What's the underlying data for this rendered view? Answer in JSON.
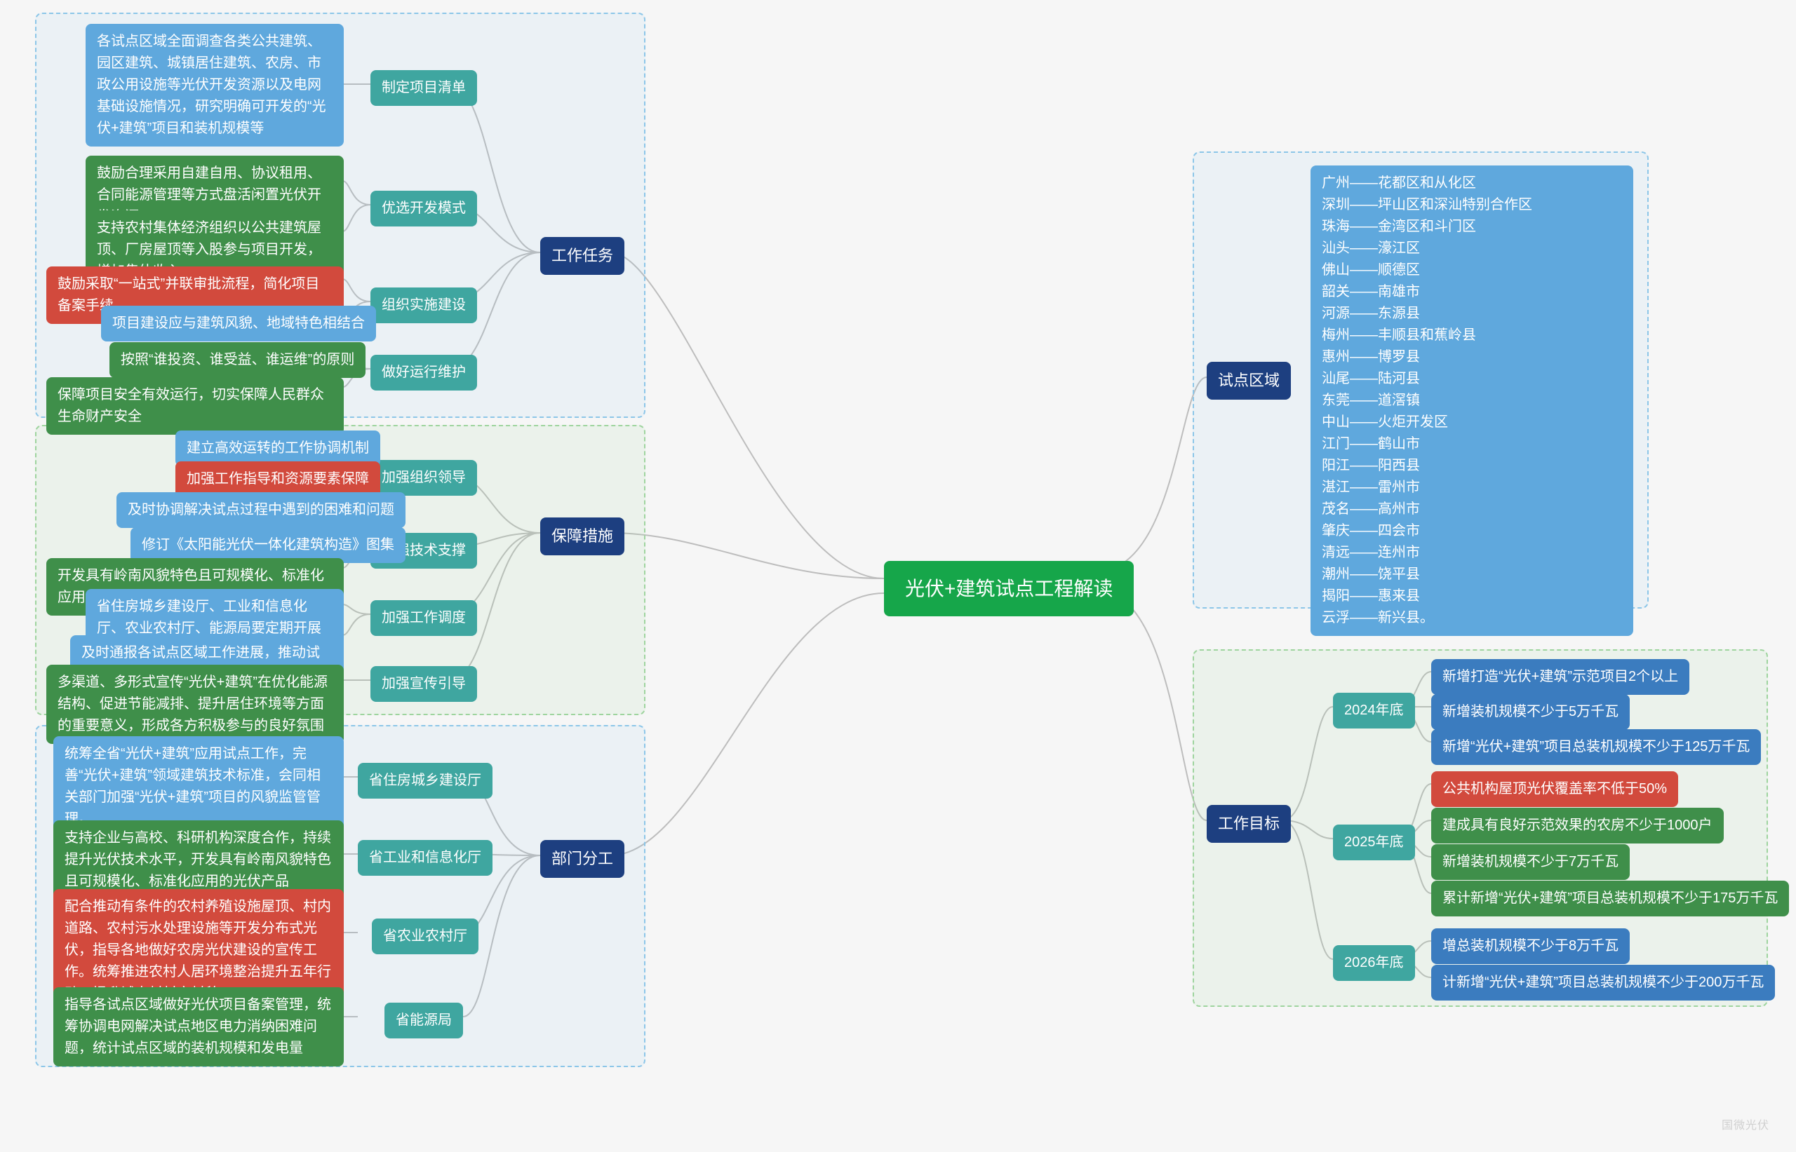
{
  "center": "光伏+建筑试点工程解读",
  "watermark": "国微光伏",
  "branches": {
    "tasks": {
      "title": "工作任务",
      "sub": [
        {
          "label": "制定项目清单",
          "leaves": [
            {
              "c": "b-blue",
              "text": "各试点区域全面调查各类公共建筑、园区建筑、城镇居住建筑、农房、市政公用设施等光伏开发资源以及电网基础设施情况，研究明确可开发的“光伏+建筑”项目和装机规模等"
            }
          ]
        },
        {
          "label": "优选开发模式",
          "leaves": [
            {
              "c": "b-green",
              "text": "鼓励合理采用自建自用、协议租用、合同能源管理等方式盘活闲置光伏开发资源"
            },
            {
              "c": "b-green",
              "text": "支持农村集体经济组织以公共建筑屋顶、厂房屋顶等入股参与项目开发，增加集体收入"
            }
          ]
        },
        {
          "label": "组织实施建设",
          "leaves": [
            {
              "c": "b-red",
              "text": "鼓励采取“一站式”并联审批流程，简化项目备案手续"
            },
            {
              "c": "b-blue",
              "text": "项目建设应与建筑风貌、地域特色相结合"
            }
          ]
        },
        {
          "label": "做好运行维护",
          "leaves": [
            {
              "c": "b-green",
              "text": "按照“谁投资、谁受益、谁运维”的原则"
            },
            {
              "c": "b-green",
              "text": "保障项目安全有效运行，切实保障人民群众生命财产安全"
            }
          ]
        }
      ]
    },
    "safeguards": {
      "title": "保障措施",
      "sub": [
        {
          "label": "加强组织领导",
          "leaves": [
            {
              "c": "b-blue",
              "text": "建立高效运转的工作协调机制"
            },
            {
              "c": "b-red",
              "text": "加强工作指导和资源要素保障"
            },
            {
              "c": "b-blue",
              "text": "及时协调解决试点过程中遇到的困难和问题"
            }
          ]
        },
        {
          "label": "加强技术支撑",
          "leaves": [
            {
              "c": "b-blue",
              "text": "修订《太阳能光伏一体化建筑构造》图集"
            },
            {
              "c": "b-green",
              "text": "开发具有岭南风貌特色且可规模化、标准化应用的光伏产品"
            }
          ]
        },
        {
          "label": "加强工作调度",
          "leaves": [
            {
              "c": "b-blue",
              "text": "省住房城乡建设厅、工业和信息化厅、农业农村厅、能源局要定期开展联合调度"
            },
            {
              "c": "b-blue",
              "text": "及时通报各试点区域工作进展，推动试点任务落地落实"
            }
          ]
        },
        {
          "label": "加强宣传引导",
          "leaves": [
            {
              "c": "b-green",
              "text": "多渠道、多形式宣传“光伏+建筑”在优化能源结构、促进节能减排、提升居住环境等方面的重要意义，形成各方积极参与的良好氛围"
            }
          ]
        }
      ]
    },
    "departments": {
      "title": "部门分工",
      "sub": [
        {
          "label": "省住房城乡建设厅",
          "leaves": [
            {
              "c": "b-blue",
              "text": "统筹全省“光伏+建筑”应用试点工作，完善“光伏+建筑”领域建筑技术标准，会同相关部门加强“光伏+建筑”项目的风貌监管管理。"
            }
          ]
        },
        {
          "label": "省工业和信息化厅",
          "leaves": [
            {
              "c": "b-green",
              "text": "支持企业与高校、科研机构深度合作，持续提升光伏技术水平，开发具有岭南风貌特色且可规模化、标准化应用的光伏产品"
            }
          ]
        },
        {
          "label": "省农业农村厅",
          "leaves": [
            {
              "c": "b-red",
              "text": "配合推动有条件的农村养殖设施屋顶、村内道路、农村污水处理设施等开发分布式光伏，指导各地做好农房光伏建设的宣传工作。统筹推进农村人居环境整治提升五年行动，提升试点村村容村貌。"
            }
          ]
        },
        {
          "label": "省能源局",
          "leaves": [
            {
              "c": "b-green",
              "text": "指导各试点区域做好光伏项目备案管理，统筹协调电网解决试点地区电力消纳困难问题，统计试点区域的装机规模和发电量"
            }
          ]
        }
      ]
    },
    "regions": {
      "title": "试点区域",
      "list_text": "广州——花都区和从化区\n深圳——坪山区和深汕特别合作区\n珠海——金湾区和斗门区\n汕头——濠江区\n佛山——顺德区\n韶关——南雄市\n河源——东源县\n梅州——丰顺县和蕉岭县\n惠州——博罗县\n汕尾——陆河县\n东莞——道滘镇\n中山——火炬开发区\n江门——鹤山市\n阳江——阳西县\n湛江——雷州市\n茂名——高州市\n肇庆——四会市\n清远——连州市\n潮州——饶平县\n揭阳——惠来县\n云浮——新兴县。"
    },
    "goals": {
      "title": "工作目标",
      "sub": [
        {
          "label": "2024年底",
          "leaves": [
            {
              "c": "b-dblue",
              "text": "新增打造“光伏+建筑”示范项目2个以上"
            },
            {
              "c": "b-dblue",
              "text": "新增装机规模不少于5万千瓦"
            },
            {
              "c": "b-dblue",
              "text": "新增“光伏+建筑”项目总装机规模不少于125万千瓦"
            }
          ]
        },
        {
          "label": "2025年底",
          "leaves": [
            {
              "c": "b-red",
              "text": "公共机构屋顶光伏覆盖率不低于50%"
            },
            {
              "c": "b-green",
              "text": "建成具有良好示范效果的农房不少于1000户"
            },
            {
              "c": "b-green",
              "text": "新增装机规模不少于7万千瓦"
            },
            {
              "c": "b-green",
              "text": "累计新增“光伏+建筑”项目总装机规模不少于175万千瓦"
            }
          ]
        },
        {
          "label": "2026年底",
          "leaves": [
            {
              "c": "b-dblue",
              "text": "增总装机规模不少于8万千瓦"
            },
            {
              "c": "b-dblue",
              "text": "计新增“光伏+建筑”项目总装机规模不少于200万千瓦"
            }
          ]
        }
      ]
    }
  },
  "chart_data": {
    "type": "mindmap",
    "root": "光伏+建筑试点工程解读",
    "branches": [
      "工作任务",
      "保障措施",
      "部门分工",
      "试点区域",
      "工作目标"
    ]
  }
}
